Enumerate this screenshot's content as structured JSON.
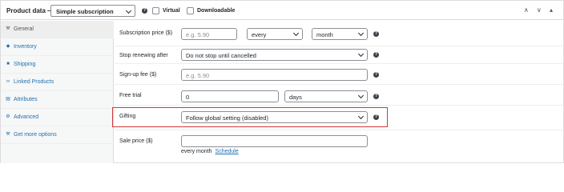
{
  "header": {
    "title": "Product data —",
    "product_type": "Simple subscription",
    "virtual_label": "Virtual",
    "downloadable_label": "Downloadable",
    "arrows": "∧ ∨ ▴"
  },
  "sidebar": {
    "items": [
      {
        "label": "General",
        "icon": "wrench-icon",
        "glyph": "⚒"
      },
      {
        "label": "Inventory",
        "icon": "tag-icon",
        "glyph": "◆"
      },
      {
        "label": "Shipping",
        "icon": "truck-icon",
        "glyph": "■"
      },
      {
        "label": "Linked Products",
        "icon": "link-icon",
        "glyph": "∞"
      },
      {
        "label": "Attributes",
        "icon": "list-icon",
        "glyph": "▤"
      },
      {
        "label": "Advanced",
        "icon": "gear-icon",
        "glyph": "⚙"
      },
      {
        "label": "Get more options",
        "icon": "plugin-icon",
        "glyph": "⚒"
      }
    ]
  },
  "fields": {
    "subscription_price": {
      "label": "Subscription price ($)",
      "placeholder": "e.g. 5.90",
      "interval": "every",
      "period": "month"
    },
    "stop_renewing": {
      "label": "Stop renewing after",
      "value": "Do not stop until cancelled"
    },
    "signup_fee": {
      "label": "Sign-up fee ($)",
      "placeholder": "e.g. 5.90"
    },
    "free_trial": {
      "label": "Free trial",
      "value": "0",
      "period": "days"
    },
    "gifting": {
      "label": "Gifting",
      "value": "Follow global setting (disabled)"
    },
    "sale_price": {
      "label": "Sale price ($)",
      "note": "every month",
      "schedule_link": "Schedule"
    }
  },
  "colors": {
    "highlight": "#d63638",
    "link": "#2271b1",
    "sidebar_bg": "#f6f7f7"
  }
}
